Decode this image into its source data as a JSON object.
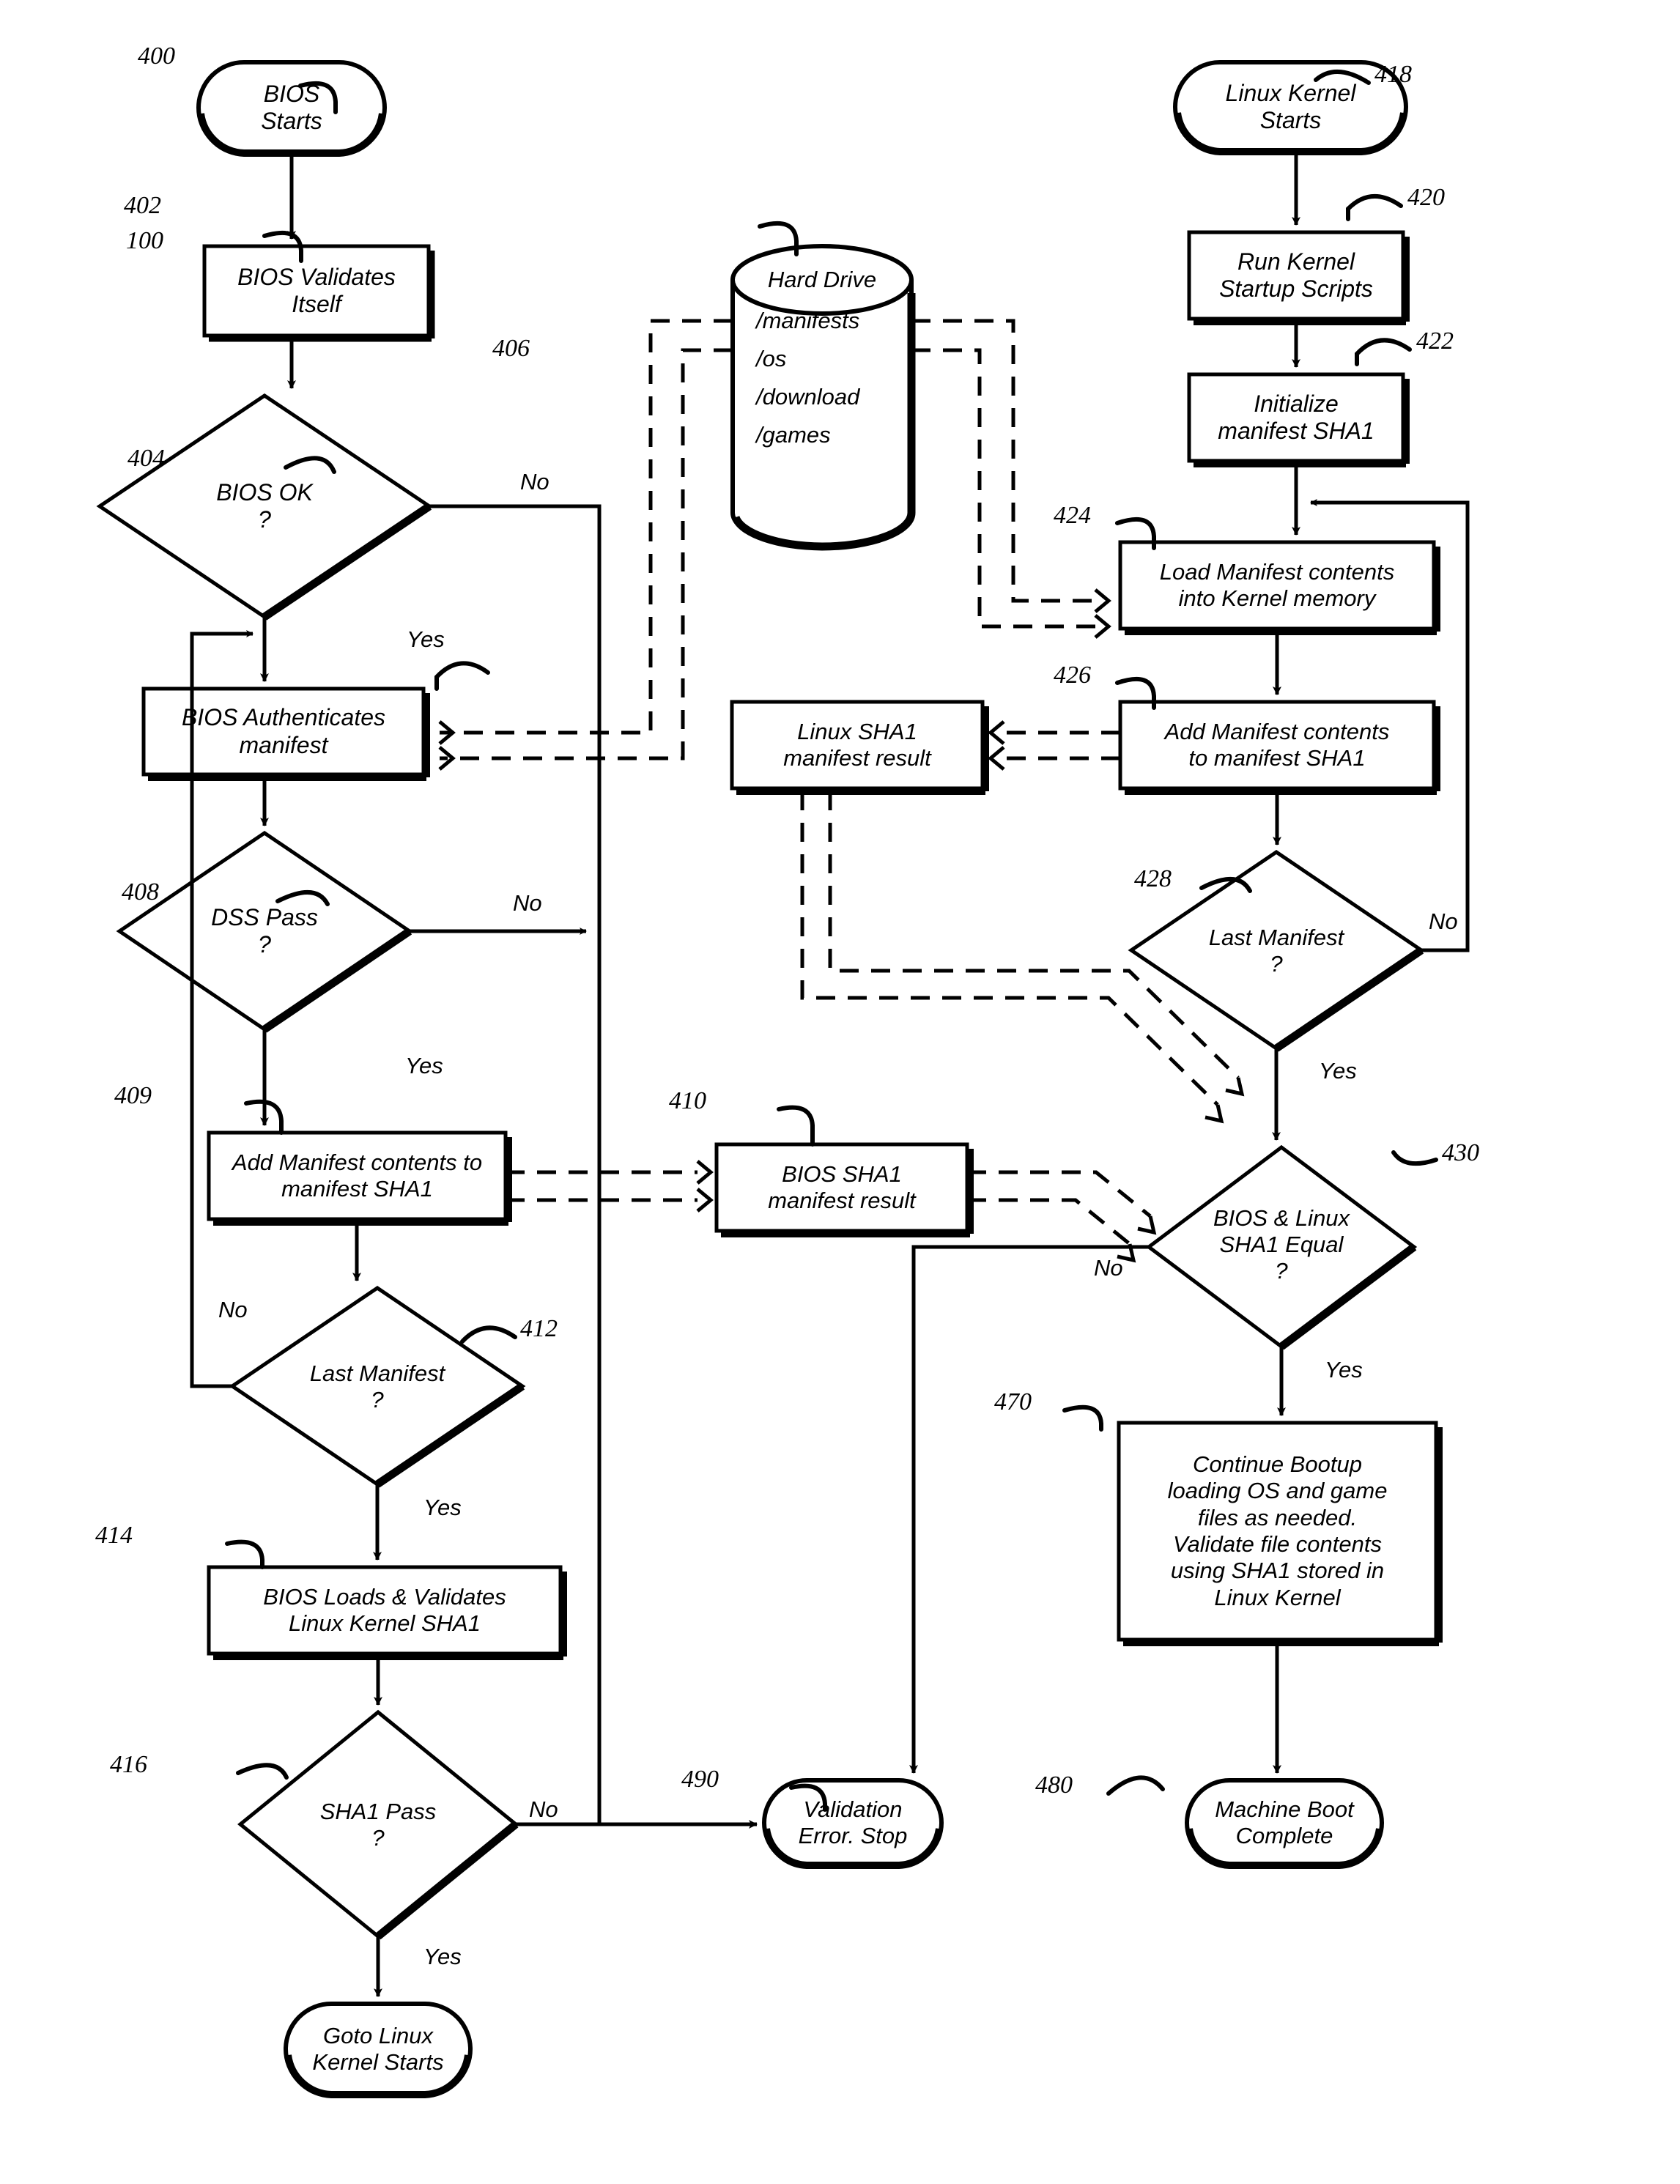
{
  "figure": {
    "type": "patent-flowchart",
    "title": "Secure boot manifest validation flow"
  },
  "nodes": {
    "n400": {
      "ref": "400",
      "shape": "terminator",
      "label": "BIOS\nStarts"
    },
    "n402": {
      "ref": "402",
      "shape": "process",
      "label": "BIOS Validates\nItself"
    },
    "n404": {
      "ref": "404",
      "shape": "decision",
      "label": "BIOS OK\n?"
    },
    "n406": {
      "ref": "406",
      "shape": "process",
      "label": "BIOS Authenticates\nmanifest"
    },
    "n408": {
      "ref": "408",
      "shape": "decision",
      "label": "DSS Pass\n?"
    },
    "n409": {
      "ref": "409",
      "shape": "process",
      "label": "Add Manifest contents to\nmanifest SHA1"
    },
    "n410": {
      "ref": "410",
      "shape": "process",
      "label": "BIOS SHA1\nmanifest result"
    },
    "n412": {
      "ref": "412",
      "shape": "decision",
      "label": "Last Manifest\n?"
    },
    "n414": {
      "ref": "414",
      "shape": "process",
      "label": "BIOS Loads & Validates\nLinux Kernel SHA1"
    },
    "n416": {
      "ref": "416",
      "shape": "decision",
      "label": "SHA1 Pass\n?"
    },
    "n417": {
      "ref": "",
      "shape": "terminator",
      "label": "Goto Linux\nKernel Starts"
    },
    "n418": {
      "ref": "418",
      "shape": "terminator",
      "label": "Linux Kernel\nStarts"
    },
    "n420": {
      "ref": "420",
      "shape": "process",
      "label": "Run Kernel\nStartup Scripts"
    },
    "n422": {
      "ref": "422",
      "shape": "process",
      "label": "Initialize\nmanifest SHA1"
    },
    "n424": {
      "ref": "424",
      "shape": "process",
      "label": "Load Manifest contents\ninto Kernel memory"
    },
    "n426": {
      "ref": "426",
      "shape": "process",
      "label": "Add Manifest contents\nto manifest SHA1"
    },
    "n427": {
      "ref": "",
      "shape": "process",
      "label": "Linux SHA1\nmanifest result"
    },
    "n428": {
      "ref": "428",
      "shape": "decision",
      "label": "Last Manifest\n?"
    },
    "n430": {
      "ref": "430",
      "shape": "decision",
      "label": "BIOS & Linux\nSHA1 Equal\n?"
    },
    "n470": {
      "ref": "470",
      "shape": "process",
      "label": "Continue Bootup\nloading OS and game\nfiles as needed.\nValidate file contents\nusing SHA1 stored in\nLinux Kernel"
    },
    "n480": {
      "ref": "480",
      "shape": "terminator",
      "label": "Machine Boot\nComplete"
    },
    "n490": {
      "ref": "490",
      "shape": "terminator",
      "label": "Validation\nError. Stop"
    },
    "n100": {
      "ref": "100",
      "shape": "cylinder",
      "label": "Hard Drive",
      "entries": [
        "/manifests",
        "/os",
        "/download",
        "/games"
      ]
    }
  },
  "edge_labels": {
    "e404_no": "No",
    "e404_yes": "Yes",
    "e408_no": "No",
    "e408_yes": "Yes",
    "e412_no": "No",
    "e412_yes": "Yes",
    "e416_no": "No",
    "e416_yes": "Yes",
    "e428_no": "No",
    "e428_yes": "Yes",
    "e430_no": "No",
    "e430_yes": "Yes"
  },
  "colors": {
    "stroke": "#000000",
    "fill": "#ffffff",
    "background": "#ffffff"
  }
}
